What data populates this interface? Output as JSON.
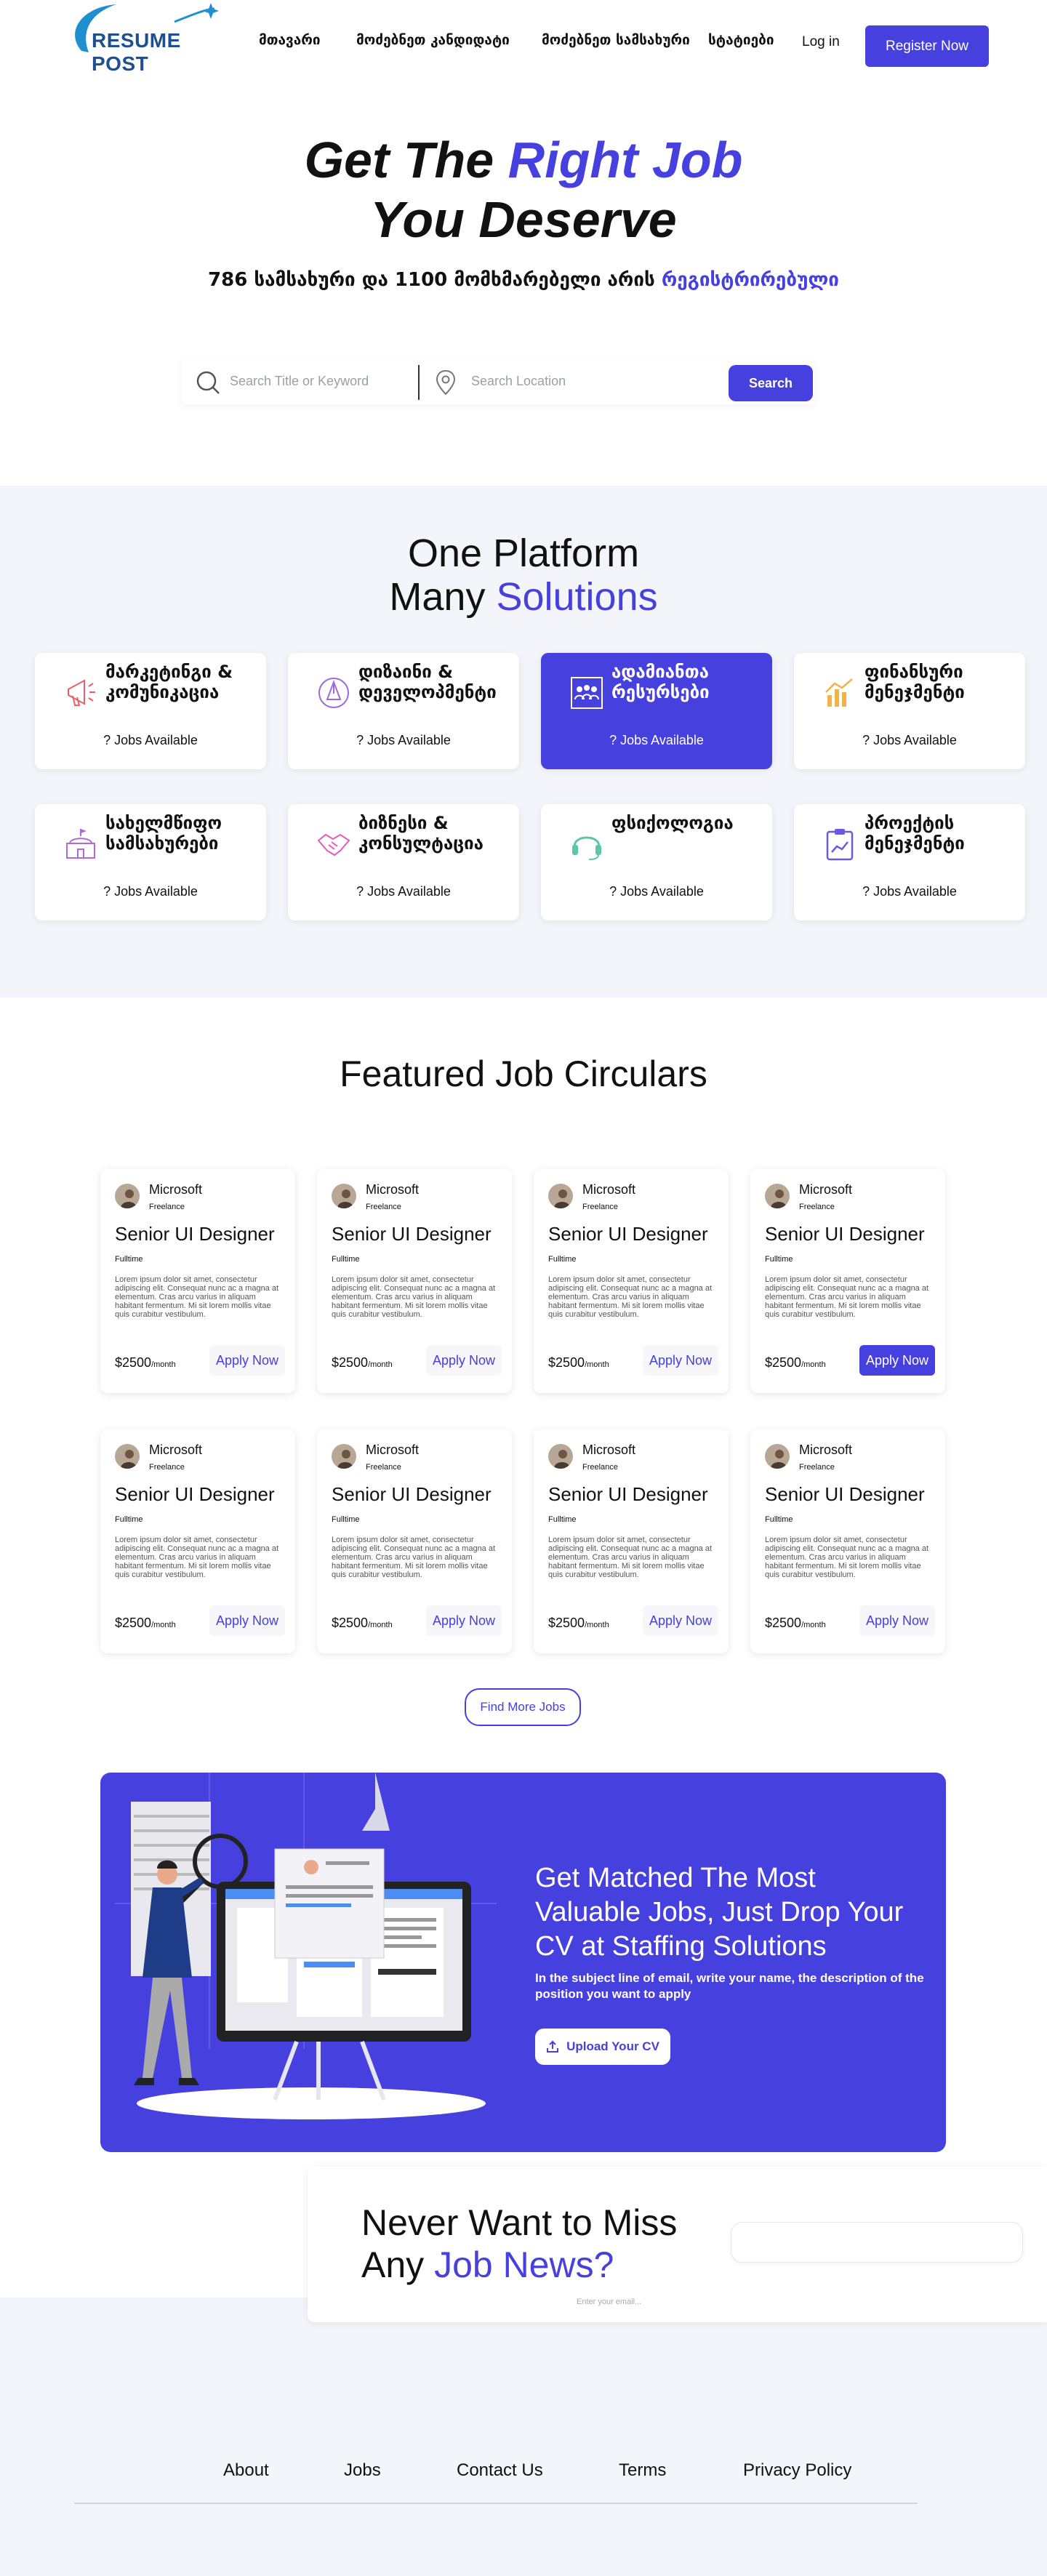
{
  "header": {
    "logo_text": "RESUME POST",
    "nav": [
      "მთავარი",
      "მოძებნეთ კანდიდატი",
      "მოძებნეთ სამსახური",
      "სტატიები"
    ],
    "login": "Log in",
    "register": "Register Now"
  },
  "hero": {
    "line1_a": "Get The ",
    "line1_b": "Right Job",
    "line2": "You Deserve",
    "sub_a": "786 სამსახური და 1100 მომხმარებელი არის ",
    "sub_b": "რეგისტრირებული",
    "search_placeholder": "Search Title or Keyword",
    "location_placeholder": "Search Location",
    "search_button": "Search"
  },
  "categories": {
    "title_line1": "One Platform",
    "title_line2_a": "Many ",
    "title_line2_b": "Solutions",
    "items": [
      {
        "title": "მარკეტინგი & კომუნიკაცია",
        "count": "? Jobs Available",
        "icon": "megaphone-icon"
      },
      {
        "title": "დიზაინი & დეველოპმენტი",
        "count": "? Jobs Available",
        "icon": "pen-tool-icon"
      },
      {
        "title": "ადამიანთა რესურსები",
        "count": "? Jobs Available",
        "icon": "people-icon",
        "active": true
      },
      {
        "title": "ფინანსური მენეჯმენტი",
        "count": "? Jobs Available",
        "icon": "chart-icon"
      },
      {
        "title": "სახელმწიფო სამსახურები",
        "count": "? Jobs Available",
        "icon": "government-building-icon"
      },
      {
        "title": "ბიზნესი & კონსულტაცია",
        "count": "? Jobs Available",
        "icon": "handshake-icon"
      },
      {
        "title": "ფსიქოლოგია",
        "count": "? Jobs Available",
        "icon": "headset-icon"
      },
      {
        "title": "პროექტის მენეჯმენტი",
        "count": "? Jobs Available",
        "icon": "clipboard-chart-icon"
      }
    ]
  },
  "jobs": {
    "title": "Featured Job Circulars",
    "cards": [
      {
        "company": "Microsoft",
        "type": "Freelance",
        "title": "Senior UI Designer",
        "employment": "Fulltime",
        "desc": "Lorem ipsum dolor sit amet, consectetur adipiscing elit. Consequat nunc ac a magna at elementum. Cras arcu varius in aliquam habitant fermentum. Mi sit lorem mollis vitae quis curabitur vestibulum.",
        "price": "$2500",
        "per": "/month",
        "apply": "Apply Now"
      },
      {
        "company": "Microsoft",
        "type": "Freelance",
        "title": "Senior UI Designer",
        "employment": "Fulltime",
        "desc": "Lorem ipsum dolor sit amet, consectetur adipiscing elit. Consequat nunc ac a magna at elementum. Cras arcu varius in aliquam habitant fermentum. Mi sit lorem mollis vitae quis curabitur vestibulum.",
        "price": "$2500",
        "per": "/month",
        "apply": "Apply Now"
      },
      {
        "company": "Microsoft",
        "type": "Freelance",
        "title": "Senior UI Designer",
        "employment": "Fulltime",
        "desc": "Lorem ipsum dolor sit amet, consectetur adipiscing elit. Consequat nunc ac a magna at elementum. Cras arcu varius in aliquam habitant fermentum. Mi sit lorem mollis vitae quis curabitur vestibulum.",
        "price": "$2500",
        "per": "/month",
        "apply": "Apply Now"
      },
      {
        "company": "Microsoft",
        "type": "Freelance",
        "title": "Senior UI Designer",
        "employment": "Fulltime",
        "desc": "Lorem ipsum dolor sit amet, consectetur adipiscing elit. Consequat nunc ac a magna at elementum. Cras arcu varius in aliquam habitant fermentum. Mi sit lorem mollis vitae quis curabitur vestibulum.",
        "price": "$2500",
        "per": "/month",
        "apply": "Apply Now",
        "highlight": true
      },
      {
        "company": "Microsoft",
        "type": "Freelance",
        "title": "Senior UI Designer",
        "employment": "Fulltime",
        "desc": "Lorem ipsum dolor sit amet, consectetur adipiscing elit. Consequat nunc ac a magna at elementum. Cras arcu varius in aliquam habitant fermentum. Mi sit lorem mollis vitae quis curabitur vestibulum.",
        "price": "$2500",
        "per": "/month",
        "apply": "Apply Now"
      },
      {
        "company": "Microsoft",
        "type": "Freelance",
        "title": "Senior UI Designer",
        "employment": "Fulltime",
        "desc": "Lorem ipsum dolor sit amet, consectetur adipiscing elit. Consequat nunc ac a magna at elementum. Cras arcu varius in aliquam habitant fermentum. Mi sit lorem mollis vitae quis curabitur vestibulum.",
        "price": "$2500",
        "per": "/month",
        "apply": "Apply Now"
      },
      {
        "company": "Microsoft",
        "type": "Freelance",
        "title": "Senior UI Designer",
        "employment": "Fulltime",
        "desc": "Lorem ipsum dolor sit amet, consectetur adipiscing elit. Consequat nunc ac a magna at elementum. Cras arcu varius in aliquam habitant fermentum. Mi sit lorem mollis vitae quis curabitur vestibulum.",
        "price": "$2500",
        "per": "/month",
        "apply": "Apply Now"
      },
      {
        "company": "Microsoft",
        "type": "Freelance",
        "title": "Senior UI Designer",
        "employment": "Fulltime",
        "desc": "Lorem ipsum dolor sit amet, consectetur adipiscing elit. Consequat nunc ac a magna at elementum. Cras arcu varius in aliquam habitant fermentum. Mi sit lorem mollis vitae quis curabitur vestibulum.",
        "price": "$2500",
        "per": "/month",
        "apply": "Apply Now"
      }
    ],
    "find_more": "Find More Jobs"
  },
  "banner": {
    "title": "Get Matched The Most Valuable Jobs, Just Drop Your CV at Staffing Solutions",
    "subtitle": "In the subject line of email, write your name, the description of the position you want to apply",
    "upload": "Upload Your CV"
  },
  "newsletter": {
    "line1": "Never Want to Miss",
    "line2_a": "Any ",
    "line2_b": "Job News?",
    "placeholder": "Enter your email..."
  },
  "footer": {
    "links": [
      "About",
      "Jobs",
      "Contact Us",
      "Terms",
      "Privacy Policy"
    ]
  },
  "colors": {
    "accent": "#4640de",
    "logo": "#1f4f8f",
    "section_bg": "#f4f5fb"
  }
}
